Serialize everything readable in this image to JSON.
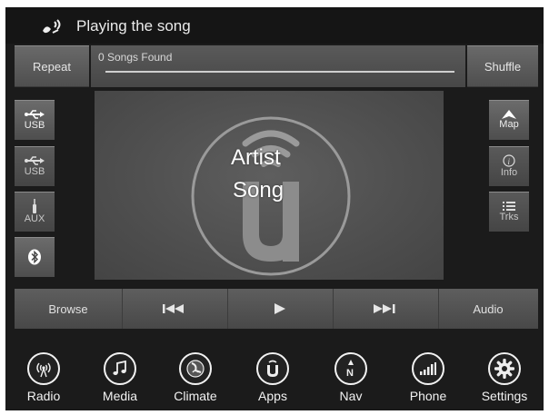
{
  "header": {
    "title": "Playing the song",
    "voice_icon": "voice-command-icon"
  },
  "controls": {
    "repeat_label": "Repeat",
    "shuffle_label": "Shuffle",
    "songs_found": "0 Songs Found"
  },
  "sources": [
    {
      "label": "USB",
      "icon": "usb-icon"
    },
    {
      "label": "USB",
      "icon": "usb-icon"
    },
    {
      "label": "AUX",
      "icon": "aux-cable-icon"
    },
    {
      "label": "",
      "icon": "bluetooth-icon"
    }
  ],
  "right_panel": [
    {
      "label": "Map",
      "icon": "map-arrow-icon"
    },
    {
      "label": "Info",
      "icon": "info-icon"
    },
    {
      "label": "Trks",
      "icon": "track-list-icon"
    }
  ],
  "now_playing": {
    "artist": "Artist",
    "song": "Song"
  },
  "transport": {
    "browse_label": "Browse",
    "audio_label": "Audio",
    "prev_icon": "previous-track-icon",
    "play_icon": "play-icon",
    "next_icon": "next-track-icon"
  },
  "bottom_nav": [
    {
      "label": "Radio",
      "icon": "radio-antenna-icon"
    },
    {
      "label": "Media",
      "icon": "music-note-icon"
    },
    {
      "label": "Climate",
      "icon": "climate-seat-icon"
    },
    {
      "label": "Apps",
      "icon": "apps-u-icon"
    },
    {
      "label": "Nav",
      "icon": "compass-icon"
    },
    {
      "label": "Phone",
      "icon": "phone-signal-icon"
    },
    {
      "label": "Settings",
      "icon": "gear-icon"
    }
  ],
  "colors": {
    "background": "#1b1b1b",
    "button": "#5c5c5c",
    "text": "#eaeaea"
  }
}
